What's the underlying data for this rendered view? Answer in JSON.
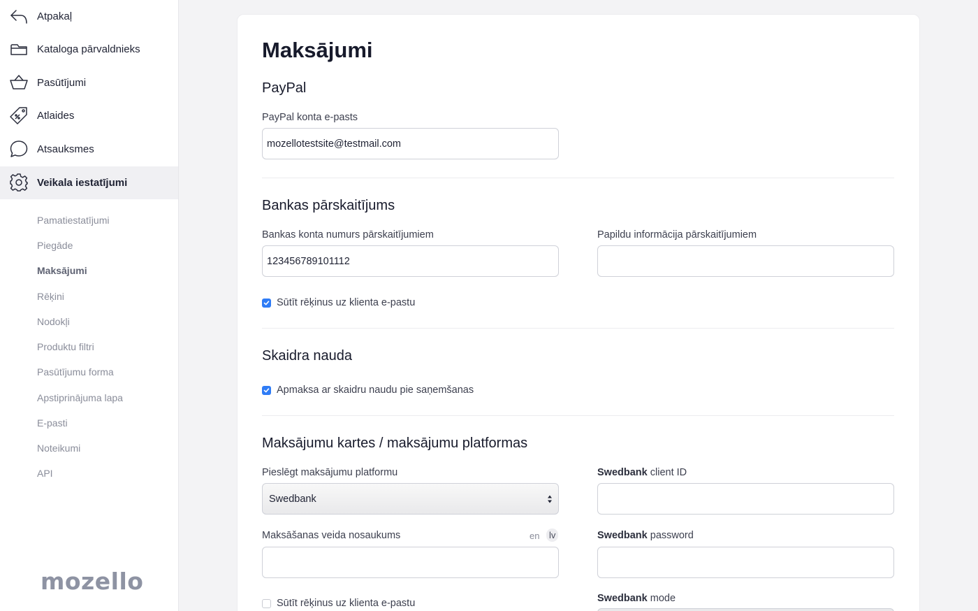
{
  "sidebar": {
    "nav": [
      {
        "label": "Atpakaļ",
        "icon": "back-arrow-icon"
      },
      {
        "label": "Kataloga pārvaldnieks",
        "icon": "folder-icon"
      },
      {
        "label": "Pasūtījumi",
        "icon": "basket-icon"
      },
      {
        "label": "Atlaides",
        "icon": "discount-tag-icon"
      },
      {
        "label": "Atsauksmes",
        "icon": "chat-bubble-icon"
      },
      {
        "label": "Veikala iestatījumi",
        "icon": "gear-icon"
      }
    ],
    "sub": [
      "Pamatiestatījumi",
      "Piegāde",
      "Maksājumi",
      "Rēķini",
      "Nodokļi",
      "Produktu filtri",
      "Pasūtījumu forma",
      "Apstiprinājuma lapa",
      "E-pasti",
      "Noteikumi",
      "API"
    ],
    "logo": "mozello"
  },
  "main": {
    "title": "Maksājumi",
    "paypal": {
      "title": "PayPal",
      "email_label": "PayPal konta e-pasts",
      "email_value": "mozellotestsite@testmail.com"
    },
    "bank": {
      "title": "Bankas pārskaitījums",
      "account_label": "Bankas konta numurs pārskaitījumiem",
      "account_value": "12345678910​1112",
      "info_label": "Papildu informācija pārskaitījumiem",
      "info_value": "",
      "send_invoice_label": "Sūtīt rēķinus uz klienta e-pastu"
    },
    "cash": {
      "title": "Skaidra nauda",
      "cod_label": "Apmaksa ar skaidru naudu pie saņemšanas"
    },
    "cards": {
      "title": "Maksājumu kartes / maksājumu platformas",
      "platform_label": "Pieslēgt maksājumu platformu",
      "platform_value": "Swedbank",
      "method_name_label": "Maksāšanas veida nosaukums",
      "lang_en": "en",
      "lang_lv": "lv",
      "method_name_value": "",
      "send_invoice_label": "Sūtīt rēķinus uz klienta e-pastu",
      "client_id_brand": "Swedbank",
      "client_id_label": "client ID",
      "password_brand": "Swedbank",
      "password_label": "password",
      "mode_brand": "Swedbank",
      "mode_label": "mode"
    }
  },
  "colors": {
    "accent": "#2f7cf6",
    "text": "#1f2233",
    "muted": "#8a8d9a",
    "background": "#f3f3f5"
  }
}
